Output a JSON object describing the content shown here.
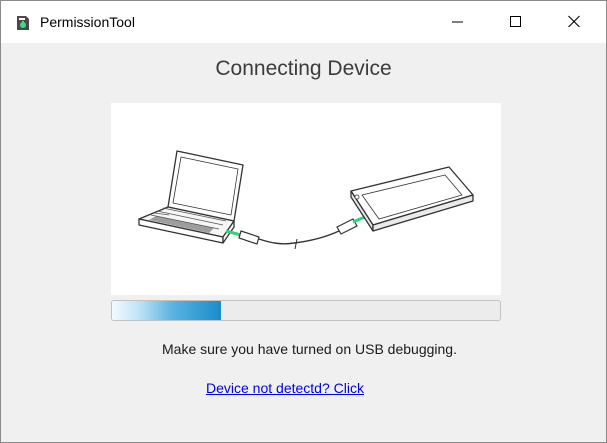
{
  "window": {
    "title": "PermissionTool",
    "controls": {
      "minimize": "minimize",
      "maximize": "maximize",
      "close": "close"
    }
  },
  "main": {
    "heading": "Connecting Device",
    "illustration": {
      "icons": [
        "laptop-icon",
        "usb-cable-icon",
        "smartphone-icon"
      ]
    },
    "progress": {
      "value_fraction": 0.28
    },
    "message": "Make sure you have turned on USB debugging.",
    "help_link": "Device not detectd? Click "
  },
  "colors": {
    "link": "#0000ee",
    "progress_fill": "#1a8ccc",
    "connector_highlight": "#2ed37a",
    "window_background": "#f0f0f0"
  }
}
